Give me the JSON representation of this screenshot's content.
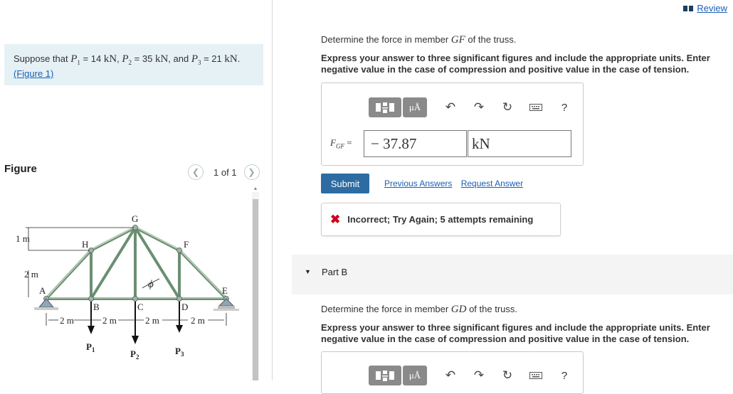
{
  "problem": {
    "text_prefix": "Suppose that ",
    "p1_sym": "P",
    "p1_sub": "1",
    "p1_val": " = 14 ",
    "p1_unit": "kN",
    "sep1": ", ",
    "p2_sym": "P",
    "p2_sub": "2",
    "p2_val": " = 35 ",
    "p2_unit": "kN",
    "sep2": ", and ",
    "p3_sym": "P",
    "p3_sub": "3",
    "p3_val": " = 21 ",
    "p3_unit": "kN",
    "end": ".",
    "figure_link": "(Figure 1)"
  },
  "figure": {
    "title": "Figure",
    "pager_text": "1 of 1",
    "prev_icon": "chevron-left-icon",
    "next_icon": "chevron-right-icon",
    "labels": {
      "G": "G",
      "H": "H",
      "F": "F",
      "A": "A",
      "E": "E",
      "B": "B",
      "C": "C",
      "D": "D",
      "dim_1m": "1 m",
      "dim_2m_v": "2 m",
      "dim_2m_a": "2 m",
      "dim_2m_b": "2 m",
      "dim_2m_c": "2 m",
      "dim_2m_d": "2 m",
      "phi": "ϕ",
      "P1": "P",
      "P1s": "1",
      "P2": "P",
      "P2s": "2",
      "P3": "P",
      "P3s": "3"
    }
  },
  "header": {
    "review_link": "Review"
  },
  "partA": {
    "question_prefix": "Determine the force in member ",
    "member": "GF",
    "question_suffix": " of the truss.",
    "instructions": "Express your answer to three significant figures and include the appropriate units. Enter negative value in the case of compression and positive value in the case of tension.",
    "toolbar": {
      "units_btn": "μÅ",
      "help": "?"
    },
    "field_label": "F",
    "field_sub": "GF",
    "field_eq": " =",
    "value": "− 37.87",
    "unit": "kN",
    "submit": "Submit",
    "previous_answers": "Previous Answers",
    "request_answer": "Request Answer",
    "feedback_msg": "Incorrect; Try Again; 5 attempts remaining"
  },
  "partB": {
    "label": "Part B",
    "question_prefix": "Determine the force in member ",
    "member": "GD",
    "question_suffix": " of the truss.",
    "instructions": "Express your answer to three significant figures and include the appropriate units. Enter negative value in the case of compression and positive value in the case of tension.",
    "toolbar": {
      "units_btn": "μÅ",
      "help": "?"
    }
  },
  "colors": {
    "accent": "#2d6ca2",
    "link": "#1a5fb4",
    "error": "#d0021b",
    "problem_bg": "#e6f1f5",
    "truss_green": "#6a8f72"
  }
}
